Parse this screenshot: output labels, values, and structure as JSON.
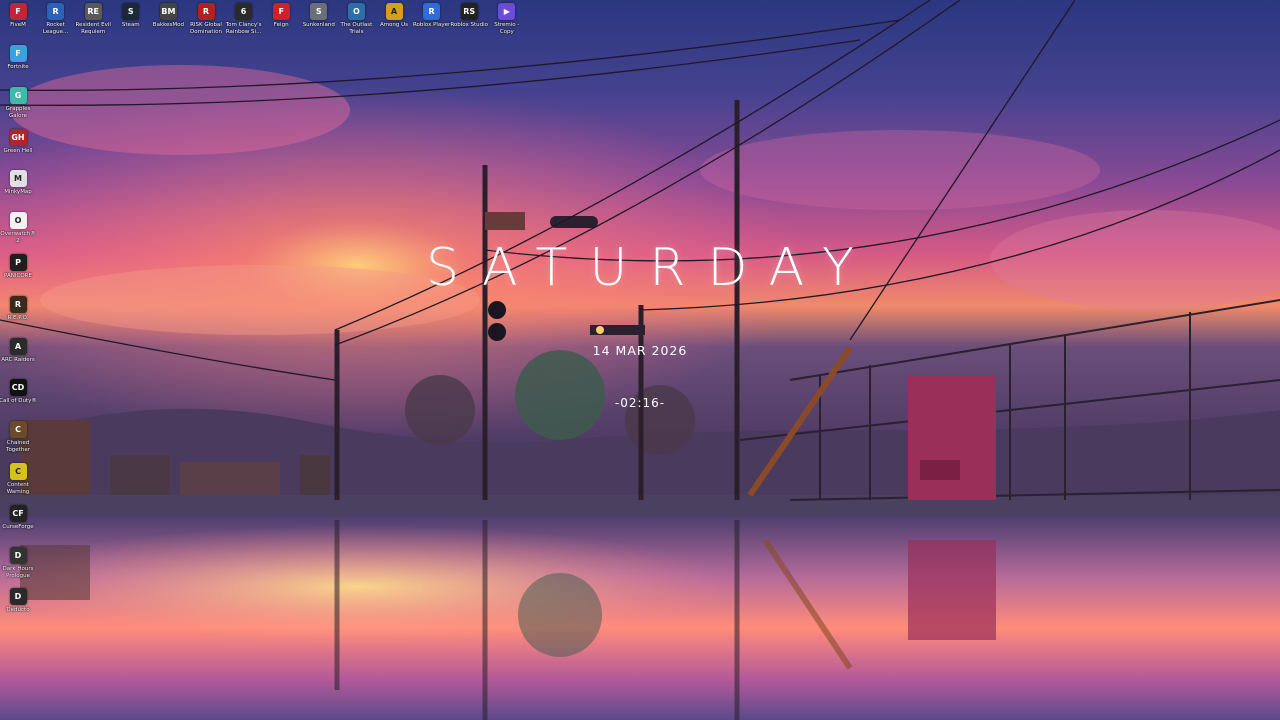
{
  "widget": {
    "day": "SATURDAY",
    "date": "14 MAR 2026",
    "time": "-02:16-"
  },
  "desktop_icons_top": [
    {
      "label": "FiveM",
      "icon": "fivem-icon",
      "color": "#c0263a",
      "glyph": "F"
    },
    {
      "label": "Rocket League...",
      "icon": "rocket-league-icon",
      "color": "#2b63b8",
      "glyph": "R"
    },
    {
      "label": "Resident Evil Requiem",
      "icon": "resident-evil-icon",
      "color": "#5a5a5a",
      "glyph": "RE"
    },
    {
      "label": "Steam",
      "icon": "steam-icon",
      "color": "#1b2838",
      "glyph": "S"
    },
    {
      "label": "BakkesMod",
      "icon": "bakkesmod-icon",
      "color": "#444444",
      "glyph": "BM"
    },
    {
      "label": "RISK Global Domination",
      "icon": "risk-icon",
      "color": "#b32020",
      "glyph": "R"
    },
    {
      "label": "Tom Clancy's Rainbow Si...",
      "icon": "rainbow-six-icon",
      "color": "#2a2a2a",
      "glyph": "6"
    },
    {
      "label": "Feign",
      "icon": "feign-icon",
      "color": "#d0202a",
      "glyph": "F"
    },
    {
      "label": "Sunkenland",
      "icon": "sunkenland-icon",
      "color": "#6b6f78",
      "glyph": "S"
    },
    {
      "label": "The Outlast Trials",
      "icon": "outlast-icon",
      "color": "#2d6da8",
      "glyph": "O"
    },
    {
      "label": "Among Us",
      "icon": "among-us-icon",
      "color": "#d4a019",
      "glyph": "A"
    },
    {
      "label": "Roblox Player",
      "icon": "roblox-player-icon",
      "color": "#2f6ae0",
      "glyph": "R"
    },
    {
      "label": "Roblox Studio",
      "icon": "roblox-studio-icon",
      "color": "#222222",
      "glyph": "RS"
    },
    {
      "label": "Stremio - Copy",
      "icon": "stremio-icon",
      "color": "#6c4bd8",
      "glyph": "▶"
    }
  ],
  "desktop_icons_left": [
    {
      "label": "Fortnite",
      "icon": "fortnite-icon",
      "color": "#3aa0e0",
      "glyph": "F"
    },
    {
      "label": "Grapples Galore",
      "icon": "grapples-galore-icon",
      "color": "#3bbba8",
      "glyph": "G"
    },
    {
      "label": "Green Hell",
      "icon": "green-hell-icon",
      "color": "#b0252a",
      "glyph": "GH"
    },
    {
      "label": "MinkyMap",
      "icon": "minkymap-icon",
      "color": "#e0e0e0",
      "glyph": "M"
    },
    {
      "label": "Overwatch® 2",
      "icon": "overwatch-icon",
      "color": "#f2f2f2",
      "glyph": "O"
    },
    {
      "label": "PANICORE",
      "icon": "panicore-icon",
      "color": "#1e1e1e",
      "glyph": "P"
    },
    {
      "label": "R.E.P.O.",
      "icon": "repo-icon",
      "color": "#3a2a1a",
      "glyph": "R"
    },
    {
      "label": "ARC Raiders",
      "icon": "arc-raiders-icon",
      "color": "#2b2b2b",
      "glyph": "A"
    },
    {
      "label": "Call of Duty®",
      "icon": "call-of-duty-icon",
      "color": "#111111",
      "glyph": "CD"
    },
    {
      "label": "Chained Together",
      "icon": "chained-together-icon",
      "color": "#6b4a2a",
      "glyph": "C"
    },
    {
      "label": "Content Warning",
      "icon": "content-warning-icon",
      "color": "#d8c11a",
      "glyph": "C"
    },
    {
      "label": "CurseForge",
      "icon": "curseforge-icon",
      "color": "#222222",
      "glyph": "CF"
    },
    {
      "label": "Dark Hours Prologue",
      "icon": "dark-hours-icon",
      "color": "#333333",
      "glyph": "D"
    },
    {
      "label": "Deducto",
      "icon": "deducto-icon",
      "color": "#2a2a2a",
      "glyph": "D"
    }
  ],
  "colors": {
    "sky_top": "#2a3a7a",
    "sky_mid": "#7a4a9a",
    "sunset": "#ff8a5a",
    "ground": "#3a3050",
    "water": "#7a5a9a"
  }
}
